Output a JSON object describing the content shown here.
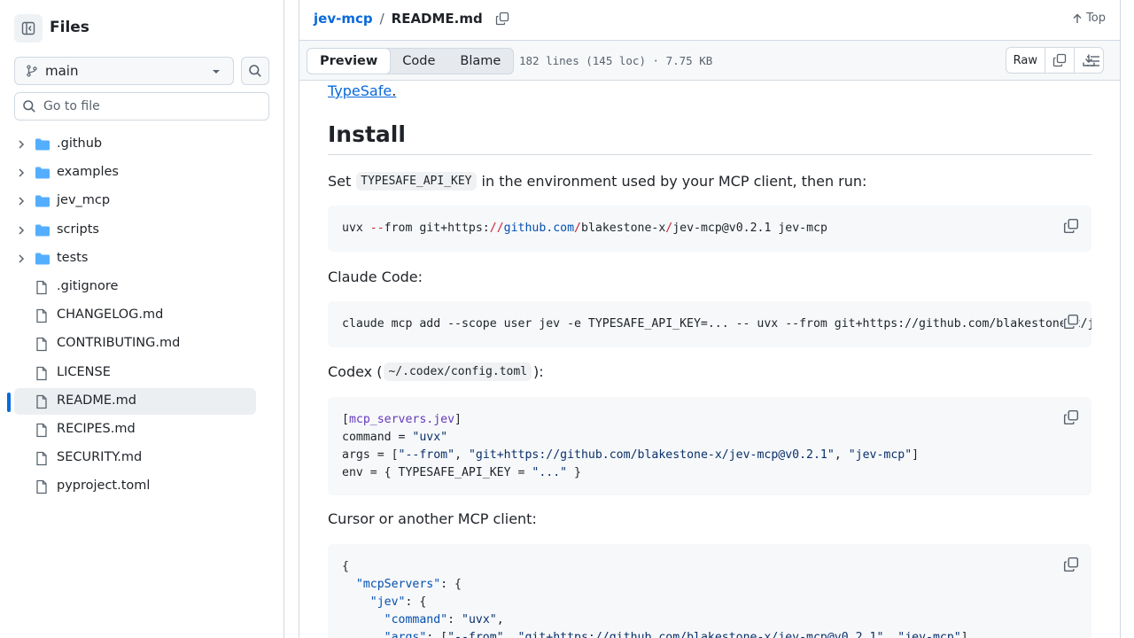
{
  "sidebar": {
    "title": "Files",
    "branch": "main",
    "search_placeholder": "Go to file",
    "items": [
      {
        "name": ".github",
        "type": "folder"
      },
      {
        "name": "examples",
        "type": "folder"
      },
      {
        "name": "jev_mcp",
        "type": "folder"
      },
      {
        "name": "scripts",
        "type": "folder"
      },
      {
        "name": "tests",
        "type": "folder"
      },
      {
        "name": ".gitignore",
        "type": "file"
      },
      {
        "name": "CHANGELOG.md",
        "type": "file"
      },
      {
        "name": "CONTRIBUTING.md",
        "type": "file"
      },
      {
        "name": "LICENSE",
        "type": "file"
      },
      {
        "name": "README.md",
        "type": "file",
        "active": true
      },
      {
        "name": "RECIPES.md",
        "type": "file"
      },
      {
        "name": "SECURITY.md",
        "type": "file"
      },
      {
        "name": "pyproject.toml",
        "type": "file"
      }
    ]
  },
  "header": {
    "repo": "jev-mcp",
    "separator": "/",
    "file": "README.md",
    "top_label": "Top"
  },
  "toolbar": {
    "tabs": [
      "Preview",
      "Code",
      "Blame"
    ],
    "active_tab": "Preview",
    "meta": "182 lines (145 loc) · 7.75 KB",
    "raw_label": "Raw"
  },
  "readme": {
    "link_text": "TypeSafe",
    "link_suffix": ".",
    "install_heading": "Install",
    "set_pre": "Set",
    "set_code": "TYPESAFE_API_KEY",
    "set_post": "in the environment used by your MCP client, then run:",
    "claude_label": "Claude Code:",
    "codex_pre": "Codex (",
    "codex_code": "~/.codex/config.toml",
    "codex_post": "):",
    "cursor_label": "Cursor or another MCP client:"
  },
  "colors": {
    "link": "#0969da",
    "accent_bar": "#0969da",
    "folder": "#54aeff",
    "border": "#d1d9e0"
  }
}
